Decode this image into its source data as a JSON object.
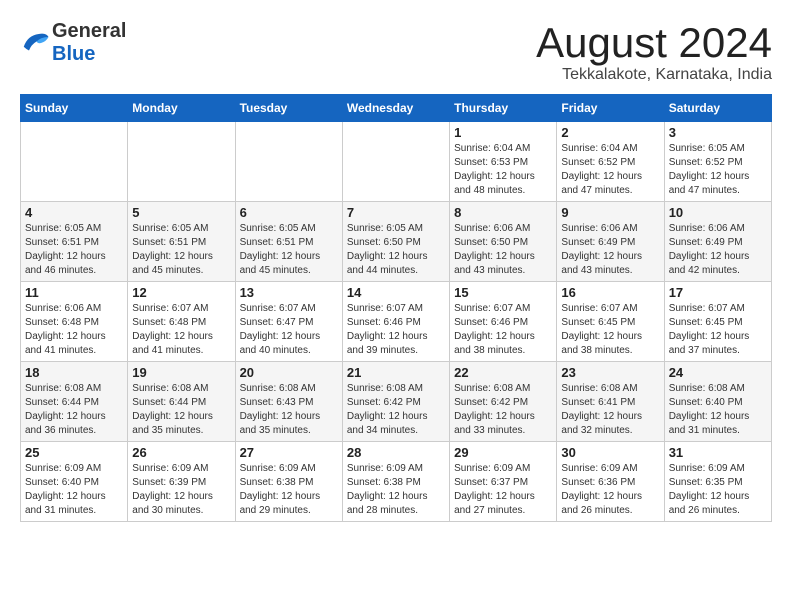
{
  "header": {
    "logo_general": "General",
    "logo_blue": "Blue",
    "title": "August 2024",
    "location": "Tekkalakote, Karnataka, India"
  },
  "calendar": {
    "days_of_week": [
      "Sunday",
      "Monday",
      "Tuesday",
      "Wednesday",
      "Thursday",
      "Friday",
      "Saturday"
    ],
    "weeks": [
      [
        {
          "day": "",
          "info": ""
        },
        {
          "day": "",
          "info": ""
        },
        {
          "day": "",
          "info": ""
        },
        {
          "day": "",
          "info": ""
        },
        {
          "day": "1",
          "info": "Sunrise: 6:04 AM\nSunset: 6:53 PM\nDaylight: 12 hours and 48 minutes."
        },
        {
          "day": "2",
          "info": "Sunrise: 6:04 AM\nSunset: 6:52 PM\nDaylight: 12 hours and 47 minutes."
        },
        {
          "day": "3",
          "info": "Sunrise: 6:05 AM\nSunset: 6:52 PM\nDaylight: 12 hours and 47 minutes."
        }
      ],
      [
        {
          "day": "4",
          "info": "Sunrise: 6:05 AM\nSunset: 6:51 PM\nDaylight: 12 hours and 46 minutes."
        },
        {
          "day": "5",
          "info": "Sunrise: 6:05 AM\nSunset: 6:51 PM\nDaylight: 12 hours and 45 minutes."
        },
        {
          "day": "6",
          "info": "Sunrise: 6:05 AM\nSunset: 6:51 PM\nDaylight: 12 hours and 45 minutes."
        },
        {
          "day": "7",
          "info": "Sunrise: 6:05 AM\nSunset: 6:50 PM\nDaylight: 12 hours and 44 minutes."
        },
        {
          "day": "8",
          "info": "Sunrise: 6:06 AM\nSunset: 6:50 PM\nDaylight: 12 hours and 43 minutes."
        },
        {
          "day": "9",
          "info": "Sunrise: 6:06 AM\nSunset: 6:49 PM\nDaylight: 12 hours and 43 minutes."
        },
        {
          "day": "10",
          "info": "Sunrise: 6:06 AM\nSunset: 6:49 PM\nDaylight: 12 hours and 42 minutes."
        }
      ],
      [
        {
          "day": "11",
          "info": "Sunrise: 6:06 AM\nSunset: 6:48 PM\nDaylight: 12 hours and 41 minutes."
        },
        {
          "day": "12",
          "info": "Sunrise: 6:07 AM\nSunset: 6:48 PM\nDaylight: 12 hours and 41 minutes."
        },
        {
          "day": "13",
          "info": "Sunrise: 6:07 AM\nSunset: 6:47 PM\nDaylight: 12 hours and 40 minutes."
        },
        {
          "day": "14",
          "info": "Sunrise: 6:07 AM\nSunset: 6:46 PM\nDaylight: 12 hours and 39 minutes."
        },
        {
          "day": "15",
          "info": "Sunrise: 6:07 AM\nSunset: 6:46 PM\nDaylight: 12 hours and 38 minutes."
        },
        {
          "day": "16",
          "info": "Sunrise: 6:07 AM\nSunset: 6:45 PM\nDaylight: 12 hours and 38 minutes."
        },
        {
          "day": "17",
          "info": "Sunrise: 6:07 AM\nSunset: 6:45 PM\nDaylight: 12 hours and 37 minutes."
        }
      ],
      [
        {
          "day": "18",
          "info": "Sunrise: 6:08 AM\nSunset: 6:44 PM\nDaylight: 12 hours and 36 minutes."
        },
        {
          "day": "19",
          "info": "Sunrise: 6:08 AM\nSunset: 6:44 PM\nDaylight: 12 hours and 35 minutes."
        },
        {
          "day": "20",
          "info": "Sunrise: 6:08 AM\nSunset: 6:43 PM\nDaylight: 12 hours and 35 minutes."
        },
        {
          "day": "21",
          "info": "Sunrise: 6:08 AM\nSunset: 6:42 PM\nDaylight: 12 hours and 34 minutes."
        },
        {
          "day": "22",
          "info": "Sunrise: 6:08 AM\nSunset: 6:42 PM\nDaylight: 12 hours and 33 minutes."
        },
        {
          "day": "23",
          "info": "Sunrise: 6:08 AM\nSunset: 6:41 PM\nDaylight: 12 hours and 32 minutes."
        },
        {
          "day": "24",
          "info": "Sunrise: 6:08 AM\nSunset: 6:40 PM\nDaylight: 12 hours and 31 minutes."
        }
      ],
      [
        {
          "day": "25",
          "info": "Sunrise: 6:09 AM\nSunset: 6:40 PM\nDaylight: 12 hours and 31 minutes."
        },
        {
          "day": "26",
          "info": "Sunrise: 6:09 AM\nSunset: 6:39 PM\nDaylight: 12 hours and 30 minutes."
        },
        {
          "day": "27",
          "info": "Sunrise: 6:09 AM\nSunset: 6:38 PM\nDaylight: 12 hours and 29 minutes."
        },
        {
          "day": "28",
          "info": "Sunrise: 6:09 AM\nSunset: 6:38 PM\nDaylight: 12 hours and 28 minutes."
        },
        {
          "day": "29",
          "info": "Sunrise: 6:09 AM\nSunset: 6:37 PM\nDaylight: 12 hours and 27 minutes."
        },
        {
          "day": "30",
          "info": "Sunrise: 6:09 AM\nSunset: 6:36 PM\nDaylight: 12 hours and 26 minutes."
        },
        {
          "day": "31",
          "info": "Sunrise: 6:09 AM\nSunset: 6:35 PM\nDaylight: 12 hours and 26 minutes."
        }
      ]
    ]
  }
}
